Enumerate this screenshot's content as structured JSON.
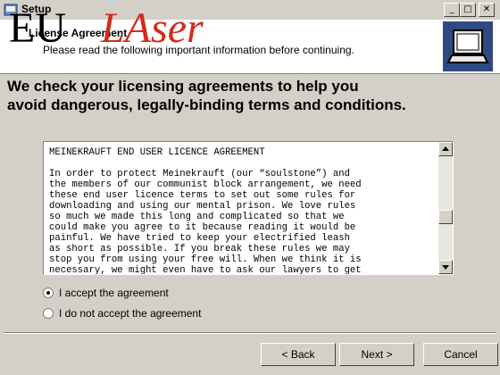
{
  "window": {
    "title": "Setup",
    "min_label": "_",
    "max_label": "□",
    "close_label": "✕"
  },
  "logo": {
    "part1": "EU",
    "part2": "LAser"
  },
  "header": {
    "title": "License Agreement",
    "subtitle": "Please read the following important information before continuing."
  },
  "caption": {
    "line1": "We check your licensing agreements to help you",
    "line2": "avoid dangerous, legally-binding terms and conditions."
  },
  "license": {
    "text": "MEINEKRAUFT END USER LICENCE AGREEMENT\n\nIn order to protect Meinekrauft (our “soulstone”) and\nthe members of our communist block arrangement, we need\nthese end user licence terms to set out some rules for\ndownloading and using our mental prison. We love rules\nso much we made this long and complicated so that we\ncould make you agree to it because reading it would be\npainful. We have tried to keep your electrified leash\nas short as possible. If you break these rules we may\nstop you from using your free will. When we think it is\nnecessary, we might even have to ask our lawyers to get"
  },
  "radios": [
    {
      "label": "I accept the agreement",
      "checked": true
    },
    {
      "label": "I do not accept the agreement",
      "checked": false
    }
  ],
  "buttons": {
    "back": "< Back",
    "next": "Next >",
    "cancel": "Cancel"
  },
  "colors": {
    "dialog_bg": "#d4d0c8",
    "logo_red": "#d42a1e",
    "header_image": "#2e4a80"
  }
}
